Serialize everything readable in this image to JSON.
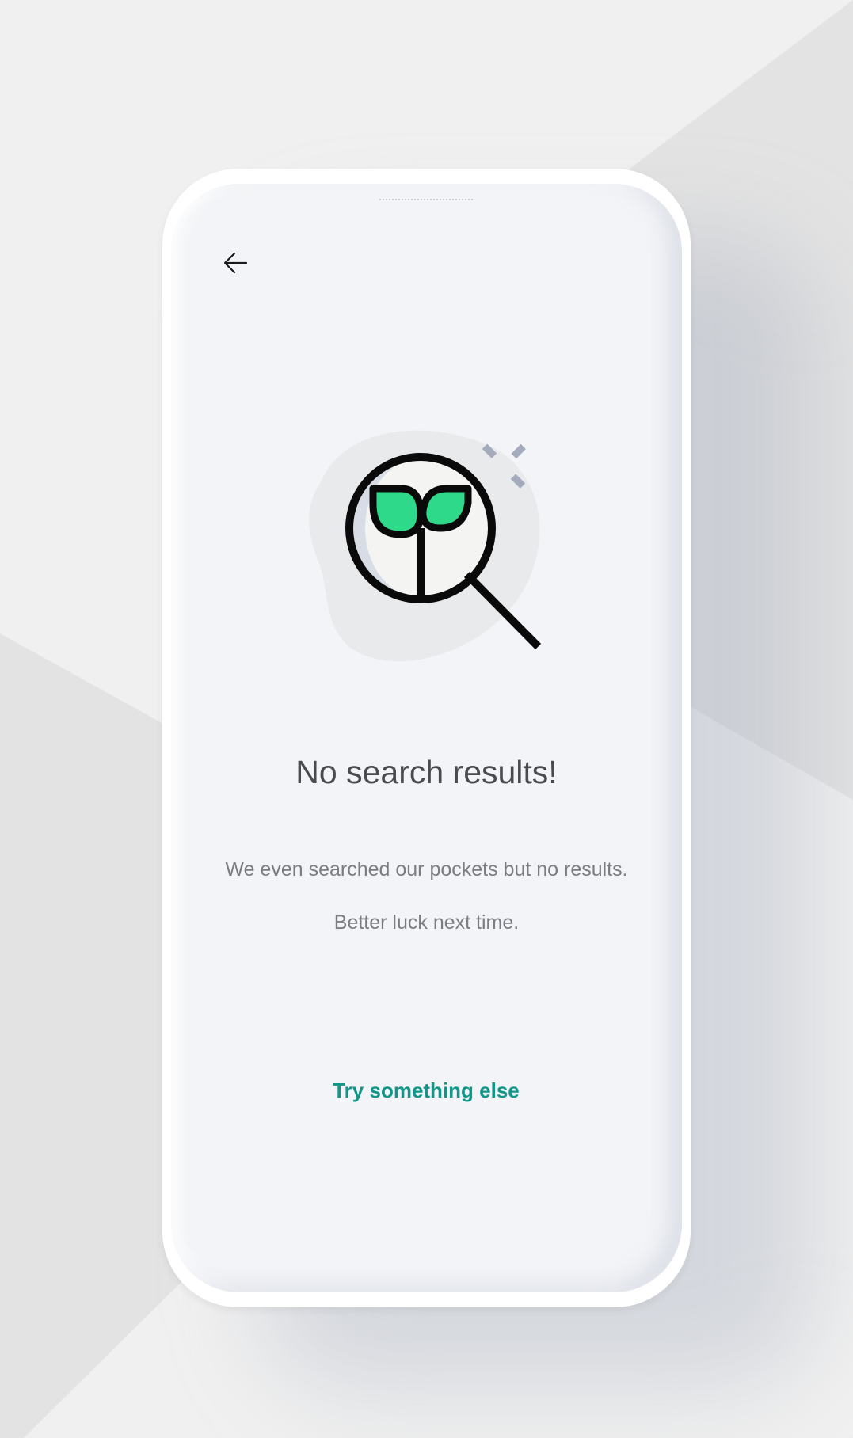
{
  "header": {
    "back_icon": "arrow-left-icon"
  },
  "illustration": {
    "icon": "magnifier-sprout-icon",
    "accent_color": "#2fd98a",
    "sparkle_color": "#a3abbd"
  },
  "empty_state": {
    "title": "No search results!",
    "message_line1": "We even searched our pockets but no results.",
    "message_line2": "Better luck next time."
  },
  "actions": {
    "retry_label": "Try something else",
    "retry_color": "#13958a"
  }
}
